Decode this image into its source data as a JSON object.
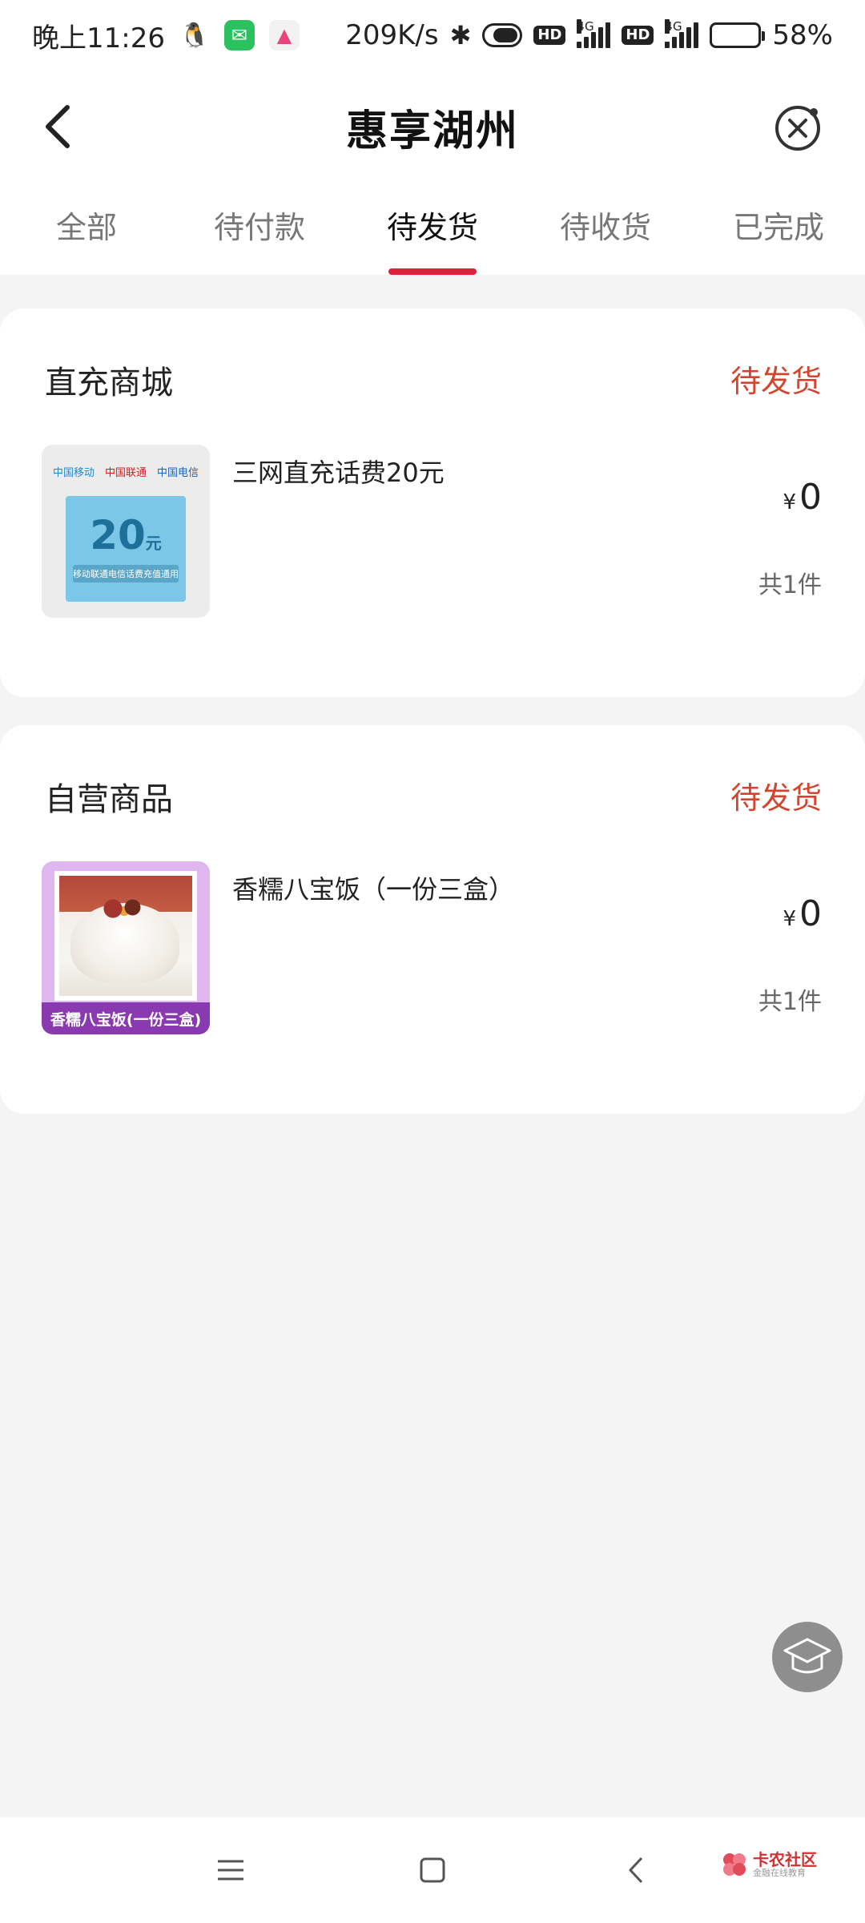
{
  "status_bar": {
    "time": "晚上11:26",
    "net_speed": "209K/s",
    "hd1": "HD",
    "hd2": "HD",
    "net1": "4G",
    "net2": "4G",
    "battery": "58%",
    "battery_level": 0.58
  },
  "header": {
    "title": "惠享湖州"
  },
  "tabs": [
    {
      "label": "全部",
      "active": false
    },
    {
      "label": "待付款",
      "active": false
    },
    {
      "label": "待发货",
      "active": true
    },
    {
      "label": "待收货",
      "active": false
    },
    {
      "label": "已完成",
      "active": false
    }
  ],
  "orders": [
    {
      "store": "直充商城",
      "status": "待发货",
      "product_name": "三网直充话费20元",
      "currency": "¥",
      "price": "0",
      "quantity": "共1件",
      "thumb": {
        "amount": "20",
        "unit": "元",
        "desc": "移动联通电信话费充值通用",
        "logo_cm": "中国移动",
        "logo_cu": "中国联通",
        "logo_ct": "中国电信"
      }
    },
    {
      "store": "自营商品",
      "status": "待发货",
      "product_name": "香糯八宝饭（一份三盒）",
      "currency": "¥",
      "price": "0",
      "quantity": "共1件",
      "thumb": {
        "caption": "香糯八宝饭(一份三盒)"
      }
    }
  ],
  "watermark": {
    "name": "卡农社区",
    "sub": "金融在线教育"
  },
  "colors": {
    "accent": "#e0203a",
    "status": "#d4452f",
    "background": "#f4f4f4"
  }
}
